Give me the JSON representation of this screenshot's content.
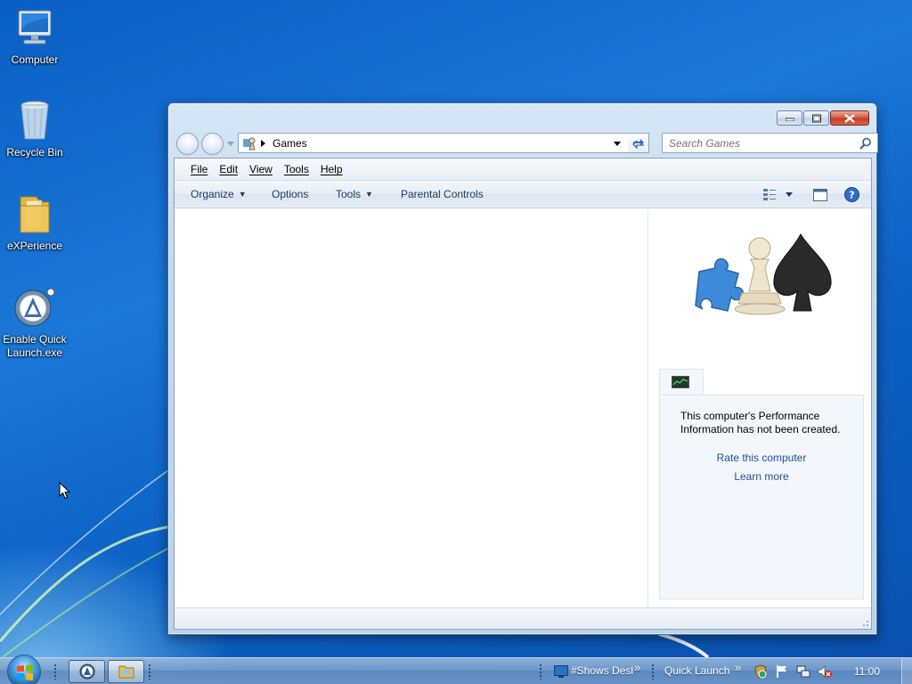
{
  "desktop": {
    "icons": [
      {
        "label": "Computer"
      },
      {
        "label": "Recycle Bin"
      },
      {
        "label": "eXPerience"
      },
      {
        "label": "Enable Quick\nLaunch.exe"
      }
    ]
  },
  "window": {
    "address": {
      "crumb": "Games"
    },
    "search": {
      "placeholder": "Search Games"
    },
    "menu": [
      "File",
      "Edit",
      "View",
      "Tools",
      "Help"
    ],
    "commands": [
      {
        "label": "Organize",
        "dropdown": true
      },
      {
        "label": "Options",
        "dropdown": false
      },
      {
        "label": "Tools",
        "dropdown": true
      },
      {
        "label": "Parental Controls",
        "dropdown": false
      }
    ],
    "perf": {
      "message": "This computer's Performance Information has not been created.",
      "link_rate": "Rate this computer",
      "link_learn": "Learn more"
    }
  },
  "taskbar": {
    "toolbar_label": "#Shows Desl",
    "quick_launch": "Quick Launch",
    "chevron": "»",
    "clock": "11:00"
  },
  "colors": {
    "accent": "#1f4e9c",
    "desktop": "#1a78d8",
    "close": "#c43a22"
  }
}
